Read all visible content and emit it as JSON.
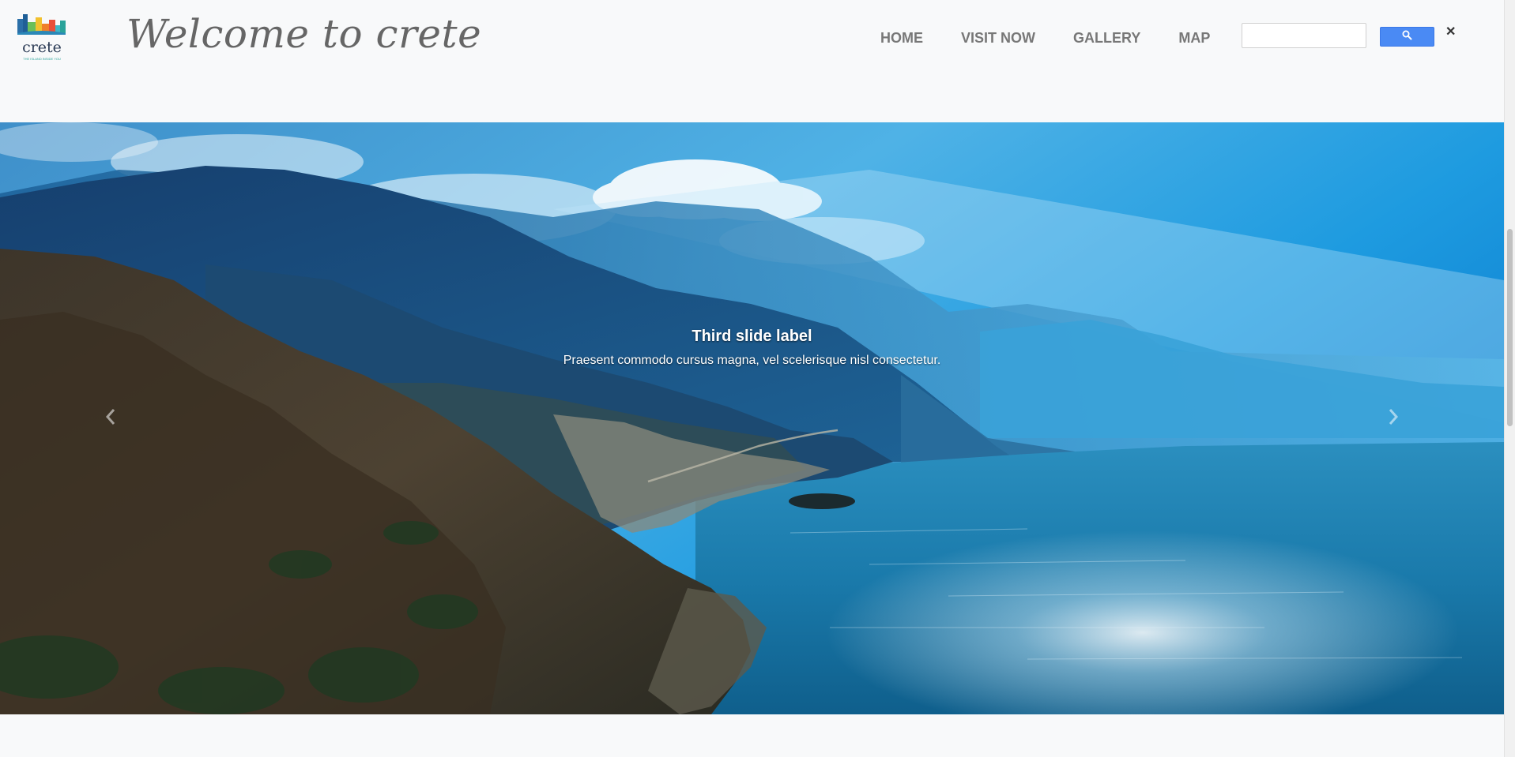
{
  "header": {
    "logo_text": "crete",
    "logo_tagline": "THE ISLAND INSIDE YOU",
    "title": "Welcome to crete",
    "nav": [
      {
        "label": "HOME"
      },
      {
        "label": "VISIT NOW"
      },
      {
        "label": "GALLERY"
      },
      {
        "label": "MAP"
      }
    ],
    "search": {
      "placeholder": "",
      "button_icon": "search-icon"
    },
    "close_glyph": "✕"
  },
  "carousel": {
    "active_index": 2,
    "slide": {
      "label": "Third slide label",
      "text": "Praesent commodo cursus magna, vel scelerisque nisl consectetur."
    },
    "prev_icon": "chevron-left-icon",
    "next_icon": "chevron-right-icon"
  },
  "colors": {
    "page_bg": "#f8f9fa",
    "nav_text": "#777777",
    "search_button": "#4a8af4",
    "sky": "#1fa2e0",
    "sea": "#1b7fb0"
  }
}
